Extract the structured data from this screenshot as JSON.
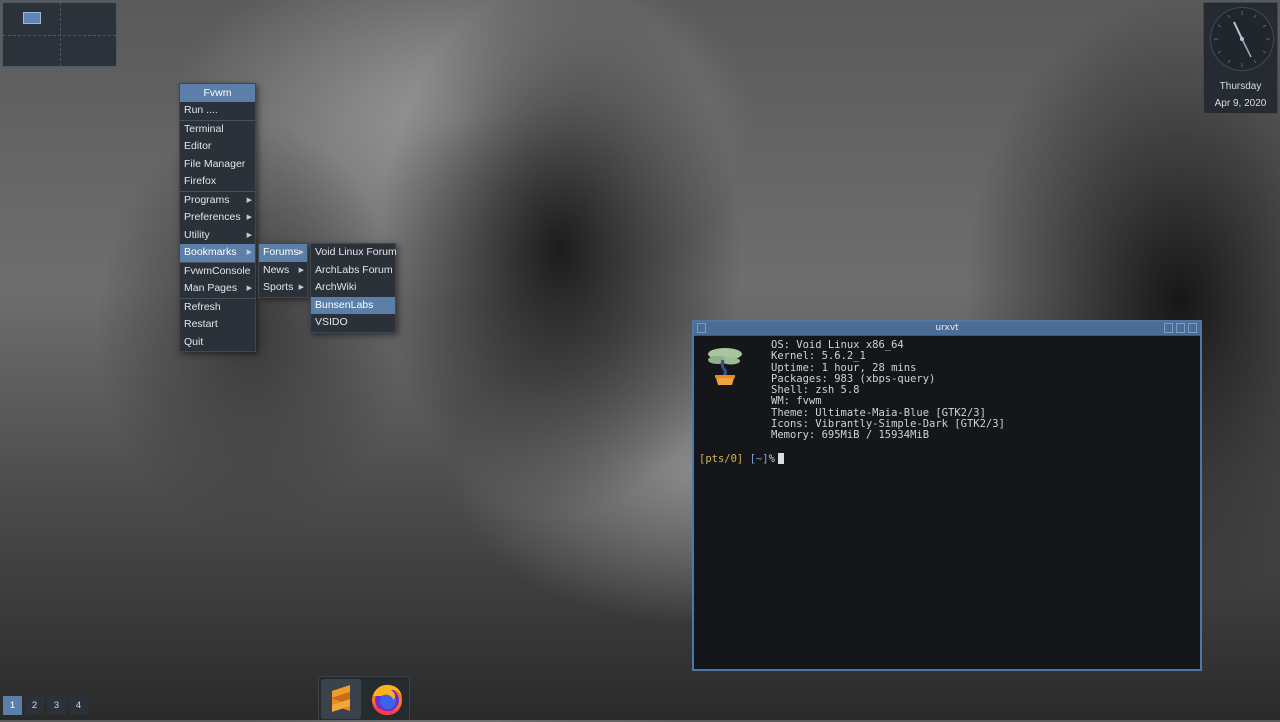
{
  "menu": {
    "title": "Fvwm",
    "items": [
      {
        "label": "Run ...."
      },
      {
        "label": "Terminal"
      },
      {
        "label": "Editor"
      },
      {
        "label": "File Manager"
      },
      {
        "label": "Firefox"
      },
      {
        "label": "Programs"
      },
      {
        "label": "Preferences"
      },
      {
        "label": "Utility"
      },
      {
        "label": "Bookmarks"
      },
      {
        "label": "FvwmConsole"
      },
      {
        "label": "Man Pages"
      },
      {
        "label": "Refresh"
      },
      {
        "label": "Restart"
      },
      {
        "label": "Quit"
      }
    ],
    "bookmarks": [
      "Forums",
      "News",
      "Sports"
    ],
    "forums": [
      "Void Linux Forum",
      "ArchLabs Forum",
      "ArchWiki",
      "BunsenLabs",
      "VSIDO"
    ]
  },
  "clock": {
    "day": "Thursday",
    "date": "Apr  9, 2020"
  },
  "terminal": {
    "title": "urxvt",
    "info": [
      "OS: Void Linux x86_64",
      "Kernel: 5.6.2_1",
      "Uptime: 1 hour, 28 mins",
      "Packages: 983 (xbps-query)",
      "Shell: zsh 5.8",
      "WM: fvwm",
      "Theme: Ultimate-Maia-Blue [GTK2/3]",
      "Icons: Vibrantly-Simple-Dark [GTK2/3]",
      "Memory: 695MiB / 15934MiB"
    ],
    "prompt_tty": "[pts/0]",
    "prompt_dir": "[~]",
    "prompt_symbol": "%"
  },
  "workspaces": [
    "1",
    "2",
    "3",
    "4"
  ],
  "dock": {
    "items": [
      {
        "icon": "sublime-text-icon"
      },
      {
        "icon": "firefox-icon"
      }
    ]
  },
  "colors": {
    "accent": "#5b7fa9",
    "menu_bg": "#2b3138",
    "terminal_bg": "#141619",
    "terminal_border": "#4f76a4",
    "prompt_yellow": "#d7b35a",
    "prompt_blue": "#7ea7d8"
  }
}
